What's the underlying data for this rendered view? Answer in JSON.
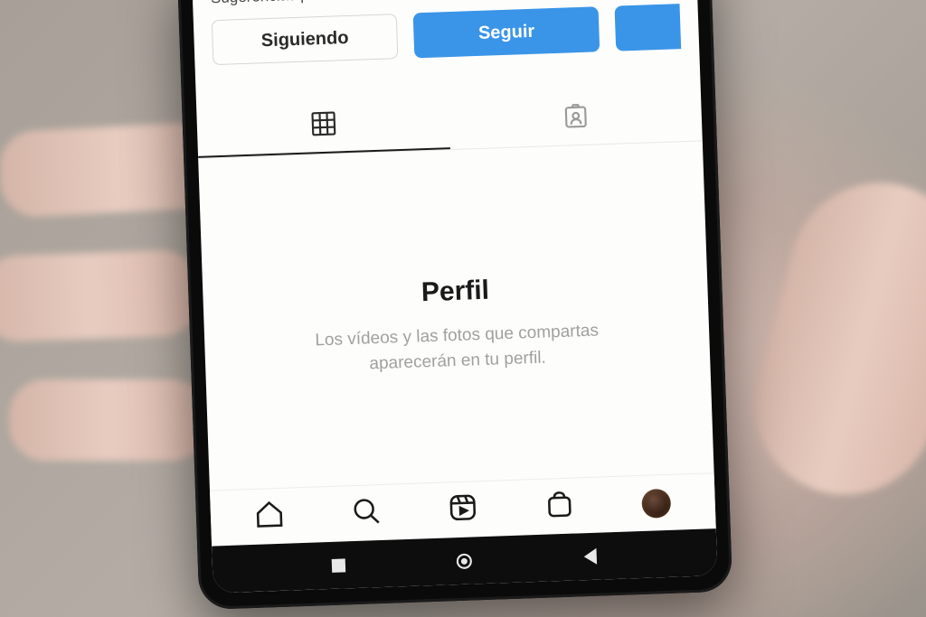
{
  "suggestions": {
    "header": "Sugerencias para ti",
    "following_label": "Siguiendo",
    "follow_label": "Seguir"
  },
  "empty_profile": {
    "title": "Perfil",
    "subtitle": "Los vídeos y las fotos que compartas aparecerán en tu perfil."
  },
  "icons": {
    "grid": "grid-icon",
    "tagged": "tagged-icon",
    "home": "home-icon",
    "search": "search-icon",
    "reels": "reels-icon",
    "shop": "shop-icon",
    "profile": "profile-avatar",
    "sys_recent": "recent-apps-icon",
    "sys_home": "home-circle-icon",
    "sys_back": "back-triangle-icon"
  }
}
